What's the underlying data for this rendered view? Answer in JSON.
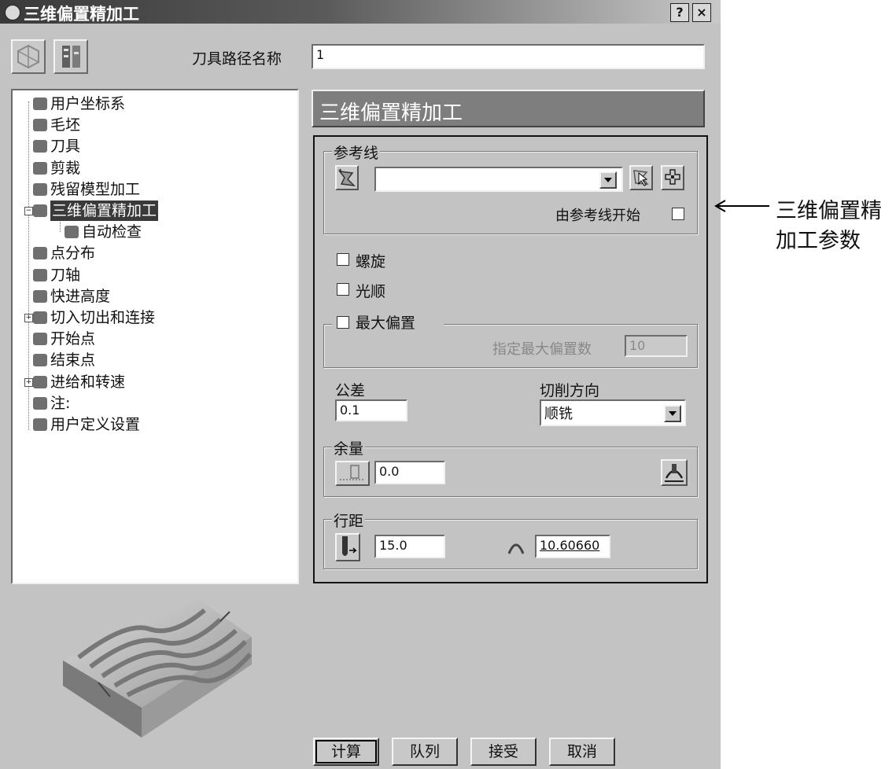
{
  "window": {
    "title": "三维偏置精加工",
    "help_label": "?",
    "close_label": "×"
  },
  "toolpath": {
    "name_label": "刀具路径名称",
    "name_value": "1"
  },
  "tree": {
    "items": [
      {
        "label": "用户坐标系",
        "icon": "ucs-icon"
      },
      {
        "label": "毛坯",
        "icon": "block-icon"
      },
      {
        "label": "刀具",
        "icon": "tool-icon"
      },
      {
        "label": "剪裁",
        "icon": "trim-icon"
      },
      {
        "label": "残留模型加工",
        "icon": "rest-model-icon"
      },
      {
        "label": "三维偏置精加工",
        "icon": "offset-finish-icon",
        "selected": true,
        "expander": "−"
      },
      {
        "label": "自动检查",
        "icon": "auto-check-icon",
        "child": true
      },
      {
        "label": "点分布",
        "icon": "point-distribution-icon"
      },
      {
        "label": "刀轴",
        "icon": "tool-axis-icon"
      },
      {
        "label": "快进高度",
        "icon": "rapid-height-icon"
      },
      {
        "label": "切入切出和连接",
        "icon": "leads-links-icon",
        "expander": "+"
      },
      {
        "label": "开始点",
        "icon": "start-point-icon"
      },
      {
        "label": "结束点",
        "icon": "end-point-icon"
      },
      {
        "label": "进给和转速",
        "icon": "feed-speed-icon",
        "expander": "+"
      },
      {
        "label": "注:",
        "icon": "notes-icon"
      },
      {
        "label": "用户定义设置",
        "icon": "user-settings-icon"
      }
    ]
  },
  "panel": {
    "header": "三维偏置精加工",
    "reference": {
      "group_label": "参考线",
      "select_value": "",
      "start_from_ref_label": "由参考线开始"
    },
    "spiral_label": "螺旋",
    "smooth_label": "光顺",
    "max_offset": {
      "group_label": "最大偏置",
      "count_label": "指定最大偏置数",
      "count_value": "10"
    },
    "tolerance": {
      "label": "公差",
      "value": "0.1"
    },
    "cut_direction": {
      "label": "切削方向",
      "value": "顺铣"
    },
    "allowance": {
      "group_label": "余量",
      "value": "0.0"
    },
    "stepover": {
      "group_label": "行距",
      "value": "15.0",
      "cusp_value": "10.60660"
    }
  },
  "buttons": {
    "calculate": "计算",
    "queue": "队列",
    "accept": "接受",
    "cancel": "取消"
  },
  "annotation": {
    "line1": "三维偏置精",
    "line2": "加工参数"
  }
}
